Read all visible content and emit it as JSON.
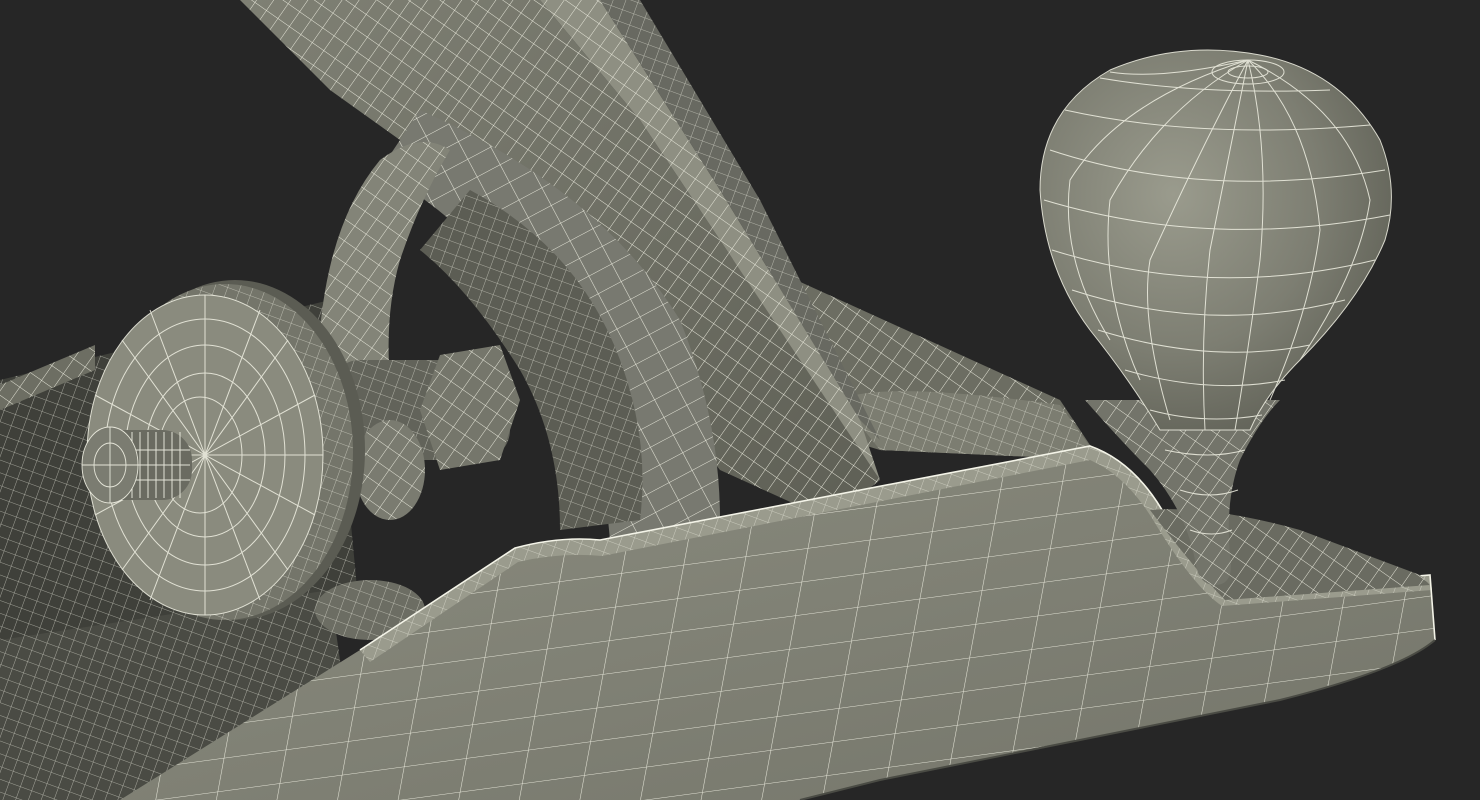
{
  "scene": {
    "subject": "wireframe-render",
    "colors": {
      "background": "#262626",
      "surface_light": "#8a8b7e",
      "surface_mid": "#74756a",
      "surface_dark": "#55564d",
      "surface_shadow": "#3c3d37",
      "wire": "#f1f1e4"
    },
    "icons": [
      "knob-icon",
      "handle-icon",
      "adjust-wheel-icon"
    ]
  }
}
